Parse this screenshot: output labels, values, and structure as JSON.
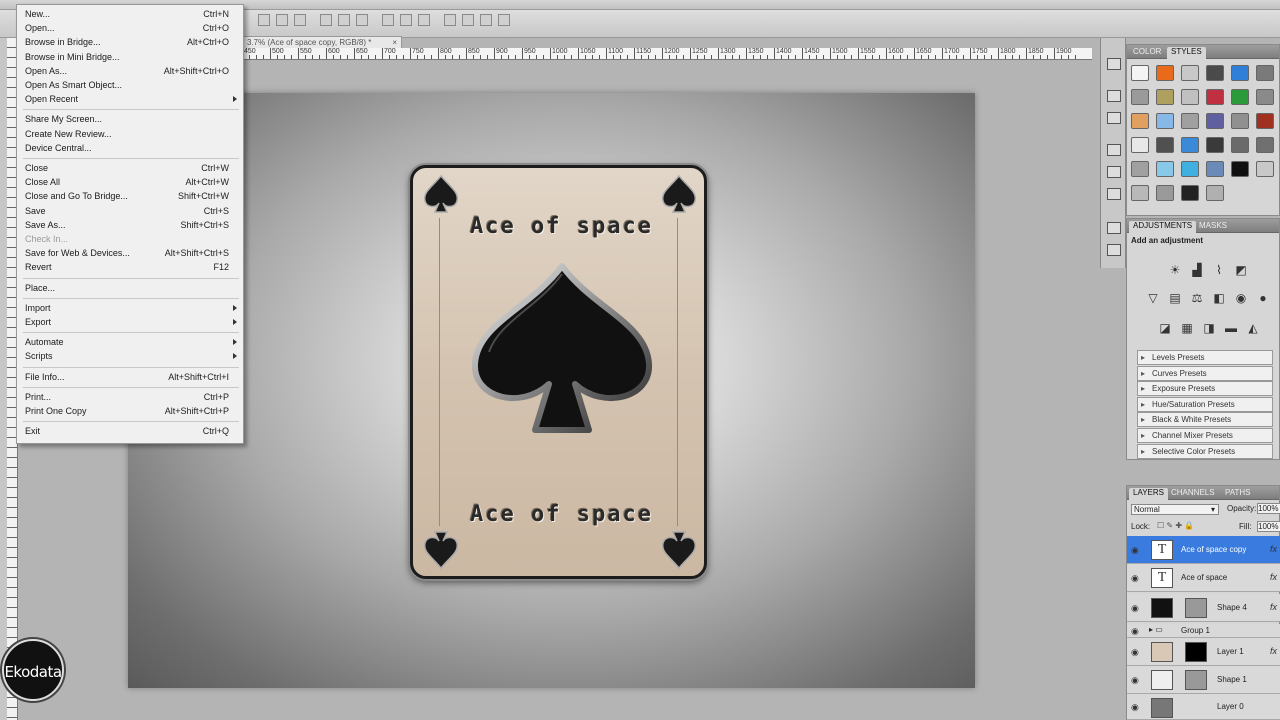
{
  "document_tab": {
    "title": "3.7% (Ace of space copy, RGB/8) *",
    "close": "×"
  },
  "ruler_ticks": [
    "450",
    "500",
    "550",
    "600",
    "650",
    "700",
    "750",
    "800",
    "850",
    "900",
    "950",
    "1000",
    "1050",
    "1100",
    "1150",
    "1200",
    "1250",
    "1300",
    "1350",
    "1400",
    "1450",
    "1500",
    "1550",
    "1600",
    "1650",
    "1700",
    "1750",
    "1800",
    "1850",
    "1900"
  ],
  "card": {
    "title_top": "Ace of space",
    "title_bottom": "Ace of space"
  },
  "file_menu": {
    "items": [
      {
        "label": "New...",
        "shortcut": "Ctrl+N"
      },
      {
        "label": "Open...",
        "shortcut": "Ctrl+O"
      },
      {
        "label": "Browse in Bridge...",
        "shortcut": "Alt+Ctrl+O"
      },
      {
        "label": "Browse in Mini Bridge...",
        "shortcut": ""
      },
      {
        "label": "Open As...",
        "shortcut": "Alt+Shift+Ctrl+O"
      },
      {
        "label": "Open As Smart Object...",
        "shortcut": ""
      },
      {
        "label": "Open Recent",
        "shortcut": "",
        "submenu": true
      },
      {
        "sep": true
      },
      {
        "label": "Share My Screen...",
        "shortcut": ""
      },
      {
        "label": "Create New Review...",
        "shortcut": ""
      },
      {
        "label": "Device Central...",
        "shortcut": ""
      },
      {
        "sep": true
      },
      {
        "label": "Close",
        "shortcut": "Ctrl+W"
      },
      {
        "label": "Close All",
        "shortcut": "Alt+Ctrl+W"
      },
      {
        "label": "Close and Go To Bridge...",
        "shortcut": "Shift+Ctrl+W"
      },
      {
        "label": "Save",
        "shortcut": "Ctrl+S"
      },
      {
        "label": "Save As...",
        "shortcut": "Shift+Ctrl+S"
      },
      {
        "label": "Check In...",
        "shortcut": "",
        "disabled": true
      },
      {
        "label": "Save for Web & Devices...",
        "shortcut": "Alt+Shift+Ctrl+S"
      },
      {
        "label": "Revert",
        "shortcut": "F12"
      },
      {
        "sep": true
      },
      {
        "label": "Place...",
        "shortcut": ""
      },
      {
        "sep": true
      },
      {
        "label": "Import",
        "shortcut": "",
        "submenu": true
      },
      {
        "label": "Export",
        "shortcut": "",
        "submenu": true
      },
      {
        "sep": true
      },
      {
        "label": "Automate",
        "shortcut": "",
        "submenu": true
      },
      {
        "label": "Scripts",
        "shortcut": "",
        "submenu": true
      },
      {
        "sep": true
      },
      {
        "label": "File Info...",
        "shortcut": "Alt+Shift+Ctrl+I"
      },
      {
        "sep": true
      },
      {
        "label": "Print...",
        "shortcut": "Ctrl+P"
      },
      {
        "label": "Print One Copy",
        "shortcut": "Alt+Shift+Ctrl+P"
      },
      {
        "sep": true
      },
      {
        "label": "Exit",
        "shortcut": "Ctrl+Q"
      }
    ]
  },
  "styles_panel": {
    "tabs": [
      "COLOR",
      "STYLES"
    ]
  },
  "adjustments_panel": {
    "tabs": [
      "ADJUSTMENTS",
      "MASKS"
    ],
    "heading": "Add an adjustment",
    "presets": [
      "Levels Presets",
      "Curves Presets",
      "Exposure Presets",
      "Hue/Saturation Presets",
      "Black & White Presets",
      "Channel Mixer Presets",
      "Selective Color Presets"
    ]
  },
  "layers_panel": {
    "tabs": [
      "LAYERS",
      "CHANNELS",
      "PATHS"
    ],
    "blend_mode": "Normal",
    "opacity_label": "Opacity:",
    "opacity_value": "100%",
    "lock_label": "Lock:",
    "fill_label": "Fill:",
    "fill_value": "100%",
    "layers": [
      {
        "name": "Ace of space copy",
        "type": "text",
        "selected": true,
        "fx": true
      },
      {
        "name": "Ace of space",
        "type": "text",
        "fx": true
      },
      {
        "name": "Shape 4",
        "type": "shape",
        "fx": true
      },
      {
        "name": "Group 1",
        "type": "group"
      },
      {
        "name": "Layer 1",
        "type": "raster",
        "fx": true
      },
      {
        "name": "Shape 1",
        "type": "shape"
      },
      {
        "name": "Layer 0",
        "type": "raster"
      }
    ]
  },
  "watermark": {
    "text": "Ekodata"
  },
  "colors": {
    "selection": "#3a7be0",
    "card_bg": "#d4c3b0",
    "menu_bg": "#f0f0f0"
  }
}
